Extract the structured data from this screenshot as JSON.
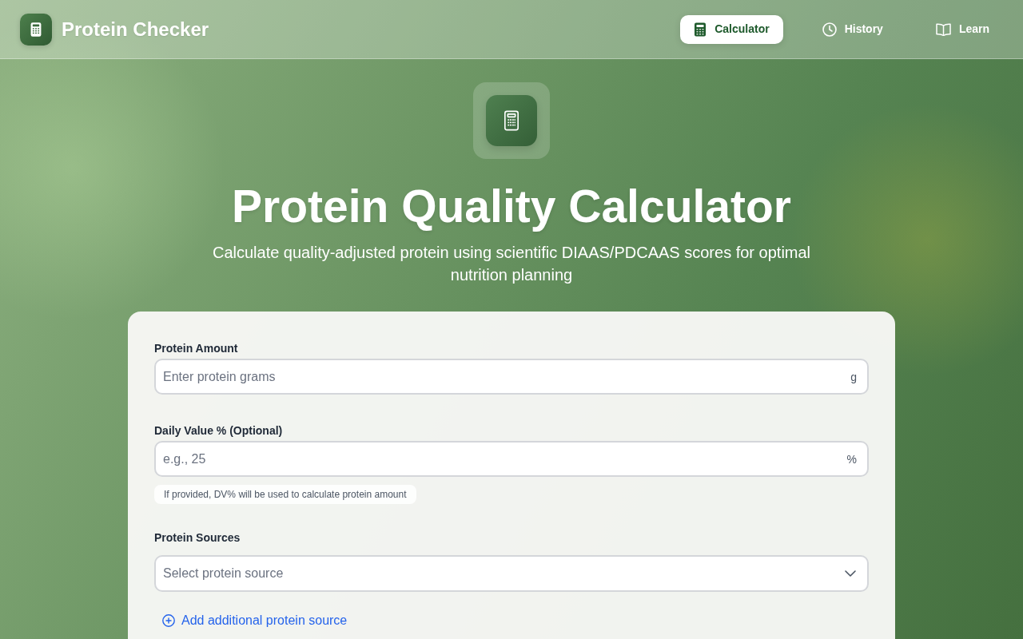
{
  "app": {
    "title": "Protein Checker"
  },
  "nav": [
    {
      "label": "Calculator",
      "selected": true
    },
    {
      "label": "History",
      "selected": false
    },
    {
      "label": "Learn",
      "selected": false
    }
  ],
  "hero": {
    "title": "Protein Quality Calculator",
    "subtitle": "Calculate quality-adjusted protein using scientific DIAAS/PDCAAS scores for optimal nutrition planning"
  },
  "form": {
    "fields": [
      {
        "kind": "input",
        "label": "Protein Amount",
        "placeholder": "Enter protein grams",
        "suffix": "g"
      },
      {
        "kind": "input",
        "label": "Daily Value % (Optional)",
        "placeholder": "e.g., 25",
        "suffix": "%",
        "hint": "If provided, DV% will be used to calculate protein amount"
      },
      {
        "kind": "select",
        "label": "Protein Sources",
        "placeholder": "Select protein source"
      }
    ],
    "add_link": "Add additional protein source"
  }
}
